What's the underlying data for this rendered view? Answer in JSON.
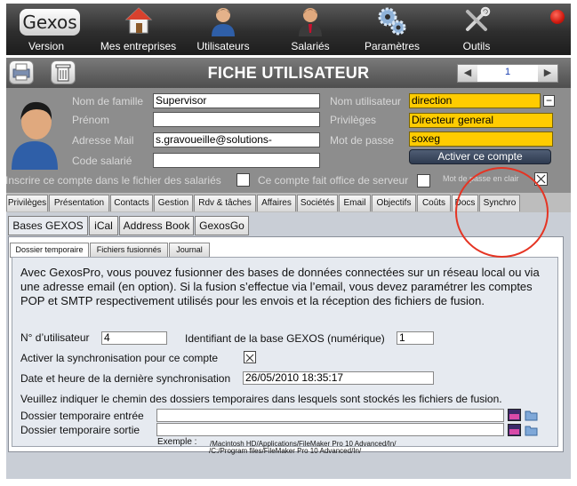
{
  "toolbar": {
    "logo": "Gexos",
    "items": [
      {
        "label": "Version",
        "icon": "gexos-logo-icon"
      },
      {
        "label": "Mes entreprises",
        "icon": "house-icon"
      },
      {
        "label": "Utilisateurs",
        "icon": "user-icon"
      },
      {
        "label": "Salariés",
        "icon": "employee-icon"
      },
      {
        "label": "Paramètres",
        "icon": "gears-icon"
      },
      {
        "label": "Outils",
        "icon": "tools-icon"
      }
    ],
    "status_color": "#d01a10"
  },
  "header": {
    "title": "FICHE UTILISATEUR",
    "record_number": "1",
    "print_icon": "printer-icon",
    "trash_icon": "trash-icon"
  },
  "user": {
    "labels": {
      "last_name": "Nom de famille",
      "first_name": "Prénom",
      "email": "Adresse Mail",
      "employee_code": "Code salarié",
      "username": "Nom utilisateur",
      "privileges": "Privilèges",
      "password": "Mot de passe"
    },
    "values": {
      "last_name": "Supervisor",
      "first_name": "",
      "email": "s.gravoueille@solutions-",
      "employee_code": "",
      "username": "direction",
      "privileges": "Directeur general",
      "password": "soxeg"
    },
    "activate_button": "Activer ce compte",
    "register_label": "Inscrire ce compte dans le fichier des salariés",
    "server_label": "Ce compte fait office de serveur",
    "clear_password_label": "Mot de passe en clair",
    "clear_password_checked": true
  },
  "tabs": [
    "Privilèges",
    "Présentation",
    "Contacts",
    "Gestion",
    "Rdv & tâches",
    "Affaires",
    "Sociétés",
    "Email",
    "Objectifs",
    "Coûts",
    "Docs",
    "Synchro"
  ],
  "active_tab": "Synchro",
  "subtabs": [
    "Bases GEXOS",
    "iCal",
    "Address Book",
    "GexosGo"
  ],
  "inner_tabs": [
    "Dossier temporaire",
    "Fichiers fusionnés",
    "Journal"
  ],
  "sync": {
    "description": "Avec GexosPro, vous pouvez fusionner des bases de données connectées sur un réseau local ou via une adresse email (en option). Si la fusion s’effectue via l’email, vous devez paramétrer les comptes POP et SMTP respectivement utilisés pour les envois et la réception des fichiers de fusion.",
    "user_number_label": "N° d’utilisateur",
    "user_number": "4",
    "base_id_label": "Identifiant de la base GEXOS (numérique)",
    "base_id": "1",
    "enable_label": "Activer la synchronisation pour ce compte",
    "enable_checked": true,
    "last_sync_label": "Date et heure de la dernière synchronisation",
    "last_sync": "26/05/2010 18:35:17",
    "folders_note": "Veuillez indiquer le chemin des dossiers temporaires dans lesquels sont stockés les fichiers de fusion.",
    "folder_in_label": "Dossier temporaire entrée",
    "folder_out_label": "Dossier temporaire sortie",
    "example_label": "Exemple :",
    "example_mac": "/Macintosh HD/Applications/FileMaker Pro 10 Advanced/In/",
    "example_win": "/C:/Program files/FileMaker Pro 10 Advanced/In/"
  },
  "annotation_color": "#e53423"
}
